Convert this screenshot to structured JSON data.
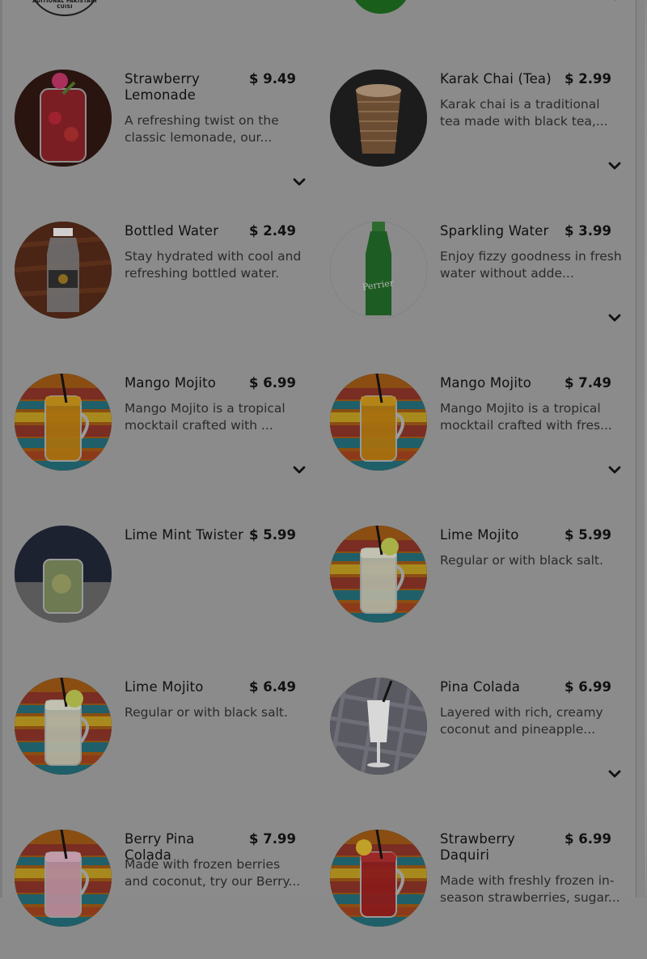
{
  "header_peek": {
    "logo_text": "ADITIONAL PAKISTANI CUISI"
  },
  "menu_items": [
    {
      "name": "Strawberry Lemonade",
      "price": "$ 9.49",
      "desc": "A refreshing twist on the classic lemonade, our...",
      "image": "strawberry-lemonade-image",
      "expand": true
    },
    {
      "name": "Karak Chai (Tea)",
      "price": "$ 2.99",
      "desc": "Karak chai is a traditional tea made with black tea,...",
      "image": "karak-chai-image",
      "expand": true
    },
    {
      "name": "Bottled Water",
      "price": "$ 2.49",
      "desc": "Stay hydrated with cool and refreshing bottled water.",
      "image": "bottled-water-image",
      "expand": false
    },
    {
      "name": "Sparkling Water",
      "price": "$ 3.99",
      "desc": "Enjoy fizzy goodness in fresh water without adde...",
      "image": "sparkling-water-image",
      "bottle_label": "Perrier",
      "expand": true
    },
    {
      "name": "Mango Mojito",
      "price": "$ 6.99",
      "desc": "Mango Mojito is a tropical mocktail crafted with ...",
      "image": "mango-mojito-image",
      "expand": true
    },
    {
      "name": "Mango Mojito",
      "price": "$ 7.49",
      "desc": "Mango Mojito is a tropical mocktail crafted with fres...",
      "image": "mango-mojito-image",
      "expand": true
    },
    {
      "name": "Lime Mint Twister",
      "price": "$ 5.99",
      "desc": "",
      "image": "lime-mint-twister-image",
      "expand": false
    },
    {
      "name": "Lime Mojito",
      "price": "$ 5.99",
      "desc": "Regular or with black salt.",
      "image": "lime-mojito-image",
      "expand": false
    },
    {
      "name": "Lime Mojito",
      "price": "$ 6.49",
      "desc": "Regular or with black salt.",
      "image": "lime-mojito-image",
      "expand": false
    },
    {
      "name": "Pina Colada",
      "price": "$ 6.99",
      "desc": "Layered with rich, creamy coconut and pineapple...",
      "image": "pina-colada-image",
      "expand": true
    },
    {
      "name": "Berry Pina Colada",
      "price": "$ 7.99",
      "desc": "Made with frozen berries and coconut, try our Berry...",
      "image": "berry-pina-colada-image",
      "expand": false
    },
    {
      "name": "Strawberry Daquiri",
      "price": "$ 6.99",
      "desc": "Made with freshly frozen in-season strawberries, sugar...",
      "image": "strawberry-daquiri-image",
      "expand": false
    }
  ],
  "colors": {
    "overlay": "#8b8b8b",
    "text": "#111111",
    "stripe_red": "#7a2d22",
    "stripe_teal": "#1f5f6a",
    "stripe_orange": "#8a4e12"
  }
}
